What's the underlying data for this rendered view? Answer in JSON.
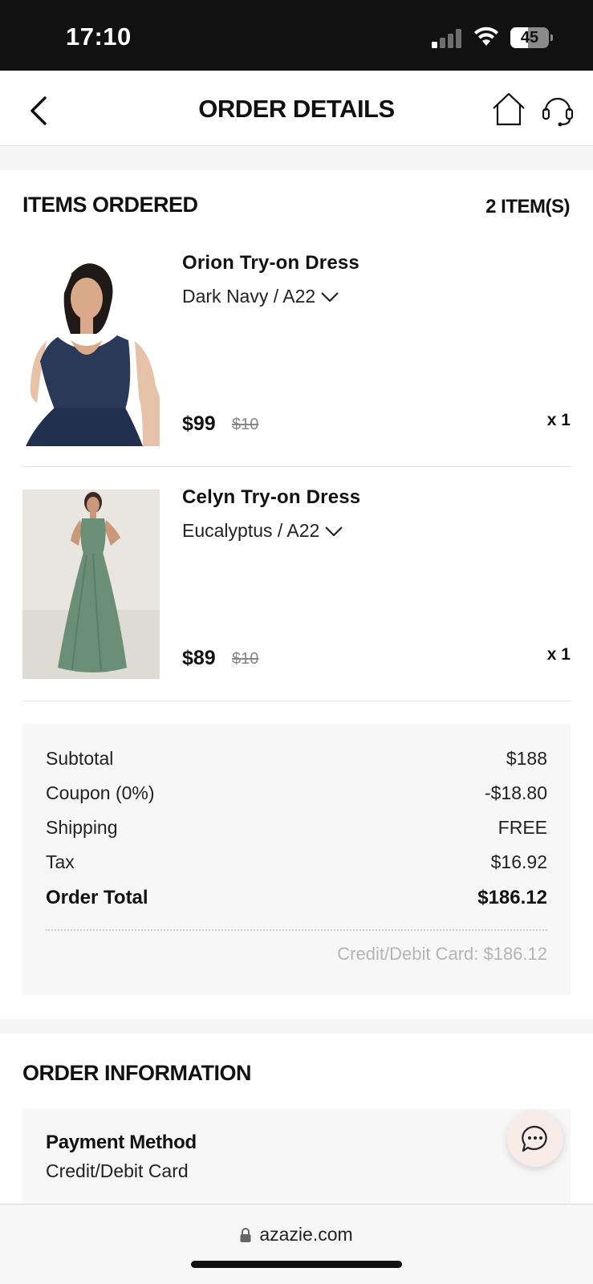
{
  "status_bar": {
    "time": "17:10",
    "battery_level": "45",
    "battery_fraction": 0.45,
    "signal_icon": "signal-bars-icon",
    "wifi_icon": "wifi-icon"
  },
  "header": {
    "title": "ORDER DETAILS",
    "back_icon": "chevron-left-icon",
    "home_icon": "home-icon",
    "support_icon": "headset-icon"
  },
  "items_ordered": {
    "title": "ITEMS ORDERED",
    "count_label": "2 ITEM(S)",
    "items": [
      {
        "name": "Orion Try-on Dress",
        "variant": "Dark Navy / A22",
        "price": "$99",
        "original_price": "$10",
        "quantity": "x 1",
        "image_color": "#2a3958"
      },
      {
        "name": "Celyn Try-on Dress",
        "variant": "Eucalyptus / A22",
        "price": "$89",
        "original_price": "$10",
        "quantity": "x 1",
        "image_color": "#6a8f76"
      }
    ]
  },
  "summary": {
    "rows": [
      {
        "label": "Subtotal",
        "value": "$188"
      },
      {
        "label": "Coupon (0%)",
        "value": "-$18.80"
      },
      {
        "label": "Shipping",
        "value": "FREE"
      },
      {
        "label": "Tax",
        "value": "$16.92"
      }
    ],
    "total_label": "Order Total",
    "total_value": "$186.12",
    "payment_note": "Credit/Debit Card: $186.12"
  },
  "order_information": {
    "title": "ORDER INFORMATION",
    "payment_method_label": "Payment Method",
    "payment_method_value": "Credit/Debit Card"
  },
  "chat": {
    "icon": "chat-bubble-icon"
  },
  "browser": {
    "url": "azazie.com",
    "lock_icon": "lock-icon"
  }
}
